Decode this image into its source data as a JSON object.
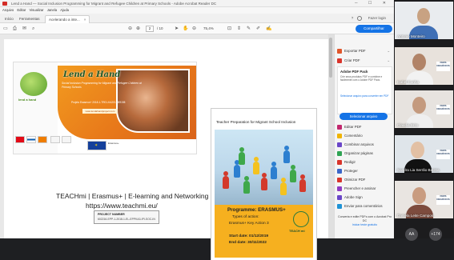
{
  "window": {
    "title": "Lend a Hand — Social Inclusion Programming for Migrant and Refugee Children at Primary Schools - Adobe Acrobat Reader DC",
    "menu": [
      "Arquivo",
      "Editar",
      "Visualizar",
      "Janela",
      "Ajuda"
    ],
    "tabs": [
      {
        "label": "Início"
      },
      {
        "label": "Ferramentas"
      },
      {
        "label": "Acelerando a inte...",
        "close": "×"
      }
    ],
    "help_label": "?",
    "login_label": "Fazer login"
  },
  "toolbar": {
    "page_current": "2",
    "page_total": "/ 10",
    "zoom": "75,4%",
    "share_label": "Compartilhar"
  },
  "leaflet": {
    "title": "Lend a Hand",
    "subtitle": "Social Inclusion Programming for Migrant and Refugee Children at Primary Schools",
    "project": "Projeto Erasmus+ 2018-1-TR01-KA201-059198",
    "url": "www.lendahandproject.com",
    "logo_text": "lend a hand"
  },
  "slide": {
    "teach_line": "TEACHmi | Erasmus+ | E-learning and Networking platform",
    "teach_url": "https://www.teachmi.eu/",
    "project_label": "PROJECT NUMBER",
    "project_number": "602216-EPP-1-2018-1-EL-EPPKA3-IPI-SOC-IN"
  },
  "brochure": {
    "title": "Teacher Preparation for Migrant School Inclusion",
    "programme": "Programme: ERASMUS+",
    "types": "Types of action:",
    "action": "Erasmus+ Key Action 3",
    "start": "Start date: 01/12/2019",
    "end": "End date: 30/11/2022",
    "logo": "TEACH mi"
  },
  "panel": {
    "tools": [
      {
        "label": "Exportar PDF",
        "color": "#e0562b"
      },
      {
        "label": "Criar PDF",
        "color": "#d9342b"
      }
    ],
    "promo_title": "Adobe PDF Pack",
    "promo_desc": "Crie seus produtos PDF e combine e facilmente com o Adobe PDF Pack.",
    "promo_link": "Selecionar arquivo para converter em PDF",
    "select_label": "Selecionar arquivo",
    "more_tools": [
      {
        "label": "Editar PDF",
        "color": "#c2286e"
      },
      {
        "label": "Comentário",
        "color": "#f0b400"
      },
      {
        "label": "Combinar arquivos",
        "color": "#6a46c8"
      },
      {
        "label": "Organizar páginas",
        "color": "#2fa353"
      },
      {
        "label": "Redigir",
        "color": "#d9342b"
      },
      {
        "label": "Proteger",
        "color": "#3b66c9"
      },
      {
        "label": "Otimizar PDF",
        "color": "#d9342b"
      },
      {
        "label": "Preencher e assinar",
        "color": "#8e3bc2"
      },
      {
        "label": "Adobe Sign",
        "color": "#6a46c8"
      },
      {
        "label": "Enviar para comentários",
        "color": "#1f93d6"
      }
    ],
    "footer_text": "Converta e edite PDFs com o Acrobat Pro DC",
    "footer_link": "Iniciar teste gratuito"
  },
  "participants": [
    {
      "name": "Antonio Monteiro",
      "bg": "#e9ecef",
      "shirt": "#3f6fb5",
      "skin": "#c8a282"
    },
    {
      "name": "Isabel Cunha",
      "bg": "#e8e2dc",
      "shirt": "#f2f2f2",
      "skin": "#b18367",
      "logo": "FERS NEGÓCIOS"
    },
    {
      "name": "Claudia Brito",
      "bg": "#e7e3df",
      "shirt": "#efefef",
      "skin": "#c49a7e",
      "logo": "FERS NEGÓCIOS"
    },
    {
      "name": "Sandra Lia Serrão Batista",
      "bg": "#dfe5ea",
      "shirt": "#111111",
      "skin": "#e2c0a4",
      "logo": "FERS NEGÓCIOS"
    },
    {
      "name": "Daniela Leite Campos",
      "bg": "#e9e5e1",
      "shirt": "#7d4c3e",
      "skin": "#c99c80",
      "logo": "FERS NEGÓCIOS"
    }
  ],
  "bottom": {
    "avatar_initials": "AA",
    "more_count": "+174"
  }
}
